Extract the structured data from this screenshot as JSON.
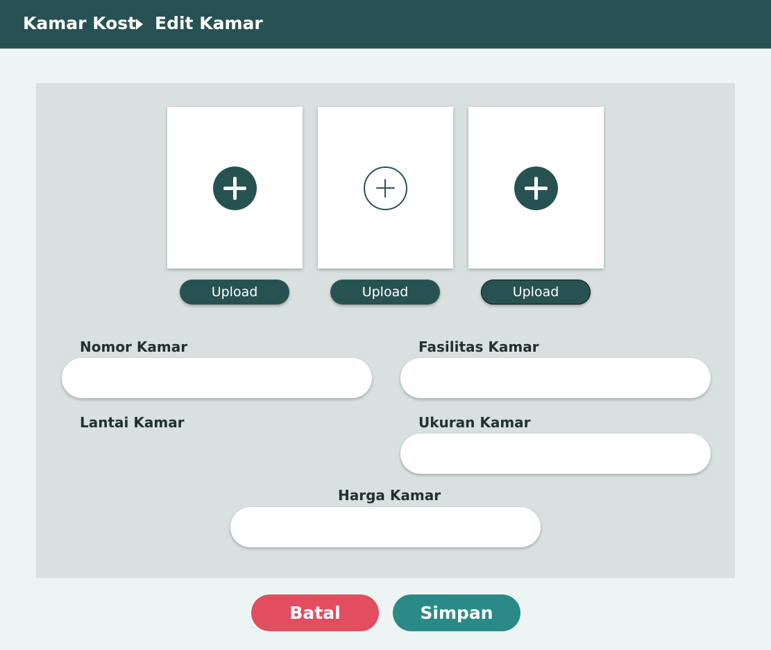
{
  "breadcrumb": {
    "root": "Kamar Kost",
    "current": "Edit Kamar"
  },
  "photos": [
    {
      "upload_label": "Upload"
    },
    {
      "upload_label": "Upload"
    },
    {
      "upload_label": "Upload"
    }
  ],
  "form": {
    "nomor_kamar": {
      "label": "Nomor Kamar",
      "value": ""
    },
    "fasilitas_kamar": {
      "label": "Fasilitas Kamar",
      "value": ""
    },
    "lantai_kamar": {
      "label": "Lantai Kamar"
    },
    "ukuran_kamar": {
      "label": "Ukuran Kamar",
      "value": ""
    },
    "harga_kamar": {
      "label": "Harga Kamar",
      "value": ""
    }
  },
  "actions": {
    "cancel_label": "Batal",
    "save_label": "Simpan"
  },
  "colors": {
    "header": "#285252",
    "cancel": "#e04e5f",
    "save": "#2a8a88",
    "panel": "#d8e1e0",
    "background": "#ecf5f4"
  }
}
